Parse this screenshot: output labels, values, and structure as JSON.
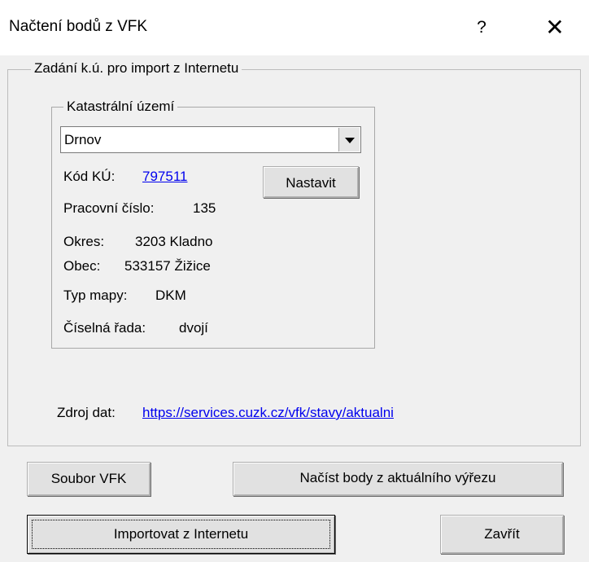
{
  "window": {
    "title": "Načtení bodů z VFK",
    "help_glyph": "?",
    "close_glyph": "✕"
  },
  "groups": {
    "outer_legend": "Zadání k.ú. pro import z Internetu",
    "inner_legend": "Katastrální území"
  },
  "cadastre": {
    "selected": "Drnov",
    "code_label": "Kód KÚ:",
    "code_value": "797511",
    "work_number_label": "Pracovní číslo:",
    "work_number_value": "135",
    "district_label": "Okres:",
    "district_value": "3203 Kladno",
    "municipality_label": "Obec:",
    "municipality_value": "533157 Žižice",
    "map_type_label": "Typ mapy:",
    "map_type_value": "DKM",
    "series_label": "Číselná řada:",
    "series_value": "dvojí"
  },
  "source": {
    "label": "Zdroj dat:",
    "url": "https://services.cuzk.cz/vfk/stavy/aktualni"
  },
  "buttons": {
    "set": "Nastavit",
    "vfk_file": "Soubor VFK",
    "load_current_view": "Načíst body z aktuálního výřezu",
    "import_internet": "Importovat z Internetu",
    "close": "Zavřít"
  }
}
